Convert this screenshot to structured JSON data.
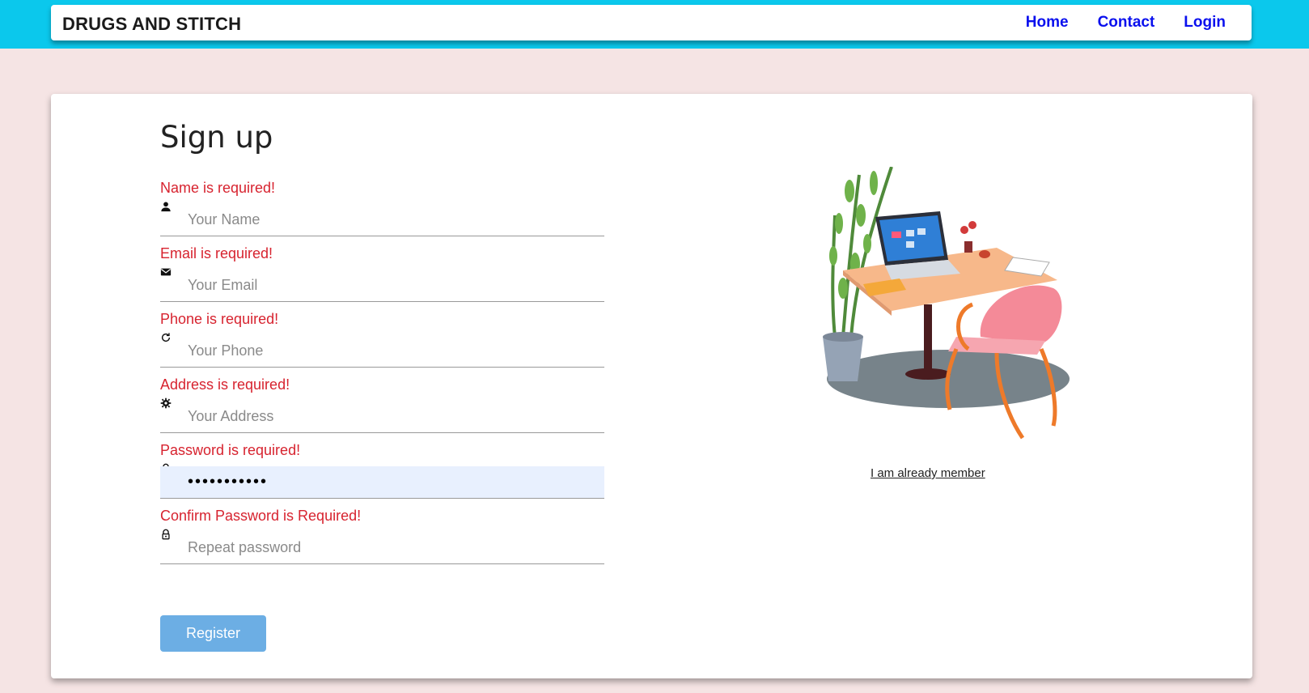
{
  "navbar": {
    "brand": "DRUGS AND STITCH",
    "links": [
      "Home",
      "Contact",
      "Login"
    ]
  },
  "form": {
    "title": "Sign up",
    "fields": [
      {
        "error": "Name is required!",
        "placeholder": "Your Name",
        "icon": "person-icon",
        "value": ""
      },
      {
        "error": "Email is required!",
        "placeholder": "Your Email",
        "icon": "envelope-icon",
        "value": ""
      },
      {
        "error": "Phone is required!",
        "placeholder": "Your Phone",
        "icon": "refresh-icon",
        "value": ""
      },
      {
        "error": "Address is required!",
        "placeholder": "Your Address",
        "icon": "gear-icon",
        "value": ""
      },
      {
        "error": "Password is required!",
        "placeholder": "",
        "icon": "lock-icon",
        "value": "•••••••••••"
      },
      {
        "error": "Confirm Password is Required!",
        "placeholder": "Repeat password",
        "icon": "lock-outline-icon",
        "value": ""
      }
    ],
    "register_label": "Register"
  },
  "aside": {
    "member_link": "I am already member",
    "image": "desk-illustration"
  },
  "colors": {
    "topband": "#0bc8ec",
    "error": "#d7232f",
    "nav_link": "#0a10ee",
    "button": "#6caee4",
    "background": "#f5e4e4"
  }
}
